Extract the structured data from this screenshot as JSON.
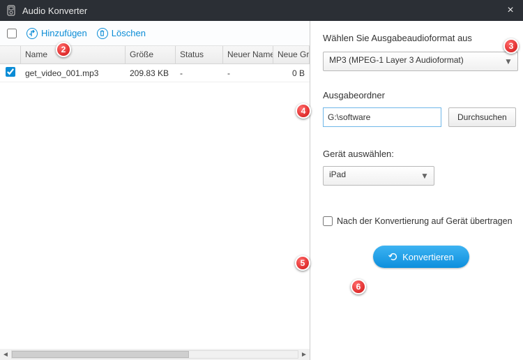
{
  "window": {
    "title": "Audio Konverter"
  },
  "toolbar": {
    "add_label": "Hinzufügen",
    "delete_label": "Löschen"
  },
  "columns": {
    "name": "Name",
    "size": "Größe",
    "status": "Status",
    "newname": "Neuer Name",
    "newsize": "Neue Grö"
  },
  "files": [
    {
      "checked": true,
      "name": "get_video_001.mp3",
      "size": "209.83 KB",
      "status": "-",
      "newname": "-",
      "newsize": "0 B"
    }
  ],
  "right": {
    "format_label": "Wählen Sie Ausgabeaudioformat aus",
    "format_value": "MP3 (MPEG-1 Layer 3 Audioformat)",
    "output_folder_label": "Ausgabeordner",
    "output_folder_value": "G:\\software",
    "browse_label": "Durchsuchen",
    "device_label": "Gerät auswählen:",
    "device_value": "iPad",
    "transfer_label": "Nach der Konvertierung auf Gerät übertragen",
    "convert_label": "Konvertieren"
  },
  "markers": {
    "m2": "2",
    "m3": "3",
    "m4": "4",
    "m5": "5",
    "m6": "6"
  }
}
